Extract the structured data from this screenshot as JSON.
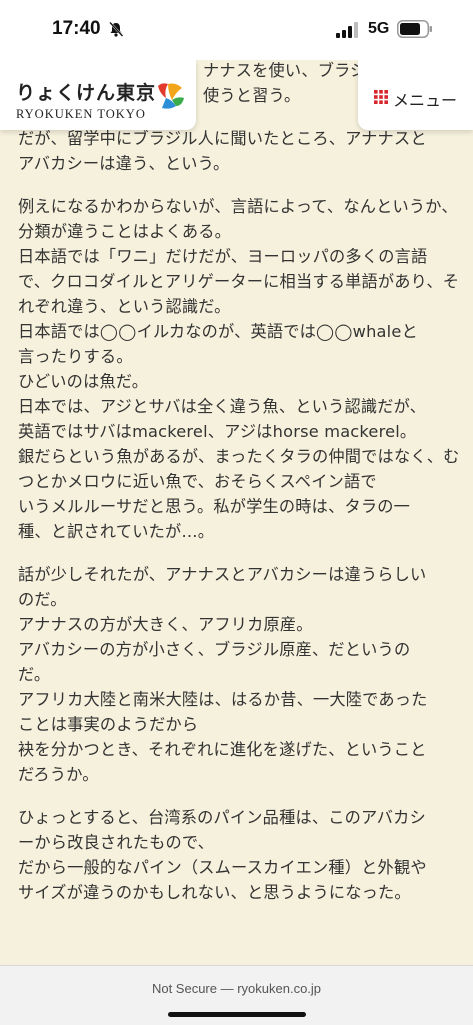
{
  "status_bar": {
    "time": "17:40",
    "network": "5G"
  },
  "header": {
    "logo_jp": "りょくけん東京",
    "logo_en": "RYOKUKEN TOKYO",
    "menu_label": "メニュー"
  },
  "article": {
    "fragment_lines": [
      "ナナスを使い、ブラジル",
      "使うと習う。"
    ],
    "paragraphs": [
      [
        "だが、留学中にブラジル人に聞いたところ、アナナスと",
        "アバカシーは違う、という。"
      ],
      [
        "例えになるかわからないが、言語によって、なんというか、分類が違うことはよくある。",
        "日本語では「ワニ」だけだが、ヨーロッパの多くの言語",
        "で、クロコダイルとアリゲーターに相当する単語があり、それぞれ違う、という認識だ。",
        "日本語では◯◯イルカなのが、英語では◯◯whaleと",
        "言ったりする。",
        "ひどいのは魚だ。",
        "日本では、アジとサバは全く違う魚、という認識だが、",
        "英語ではサバはmackerel、アジはhorse mackerel。",
        "銀だらという魚があるが、まったくタラの仲間ではなく、むつとかメロウに近い魚で、おそらくスペイン語で",
        "いうメルルーサだと思う。私が学生の時は、タラの一",
        "種、と訳されていたが…。"
      ],
      [
        "話が少しそれたが、アナナスとアバカシーは違うらしい",
        "のだ。",
        "アナナスの方が大きく、アフリカ原産。",
        "アバカシーの方が小さく、ブラジル原産、だというの",
        "だ。",
        "アフリカ大陸と南米大陸は、はるか昔、一大陸であった",
        "ことは事実のようだから",
        "袂を分かつとき、それぞれに進化を遂げた、ということ",
        "だろうか。"
      ],
      [
        "ひょっとすると、台湾系のパイン品種は、このアバカシ",
        "ーから改良されたもので、",
        "だから一般的なパイン（スムースカイエン種）と外観や",
        "サイズが違うのかもしれない、と思うようになった。"
      ]
    ]
  },
  "browser": {
    "url": "Not Secure — ryokuken.co.jp"
  }
}
